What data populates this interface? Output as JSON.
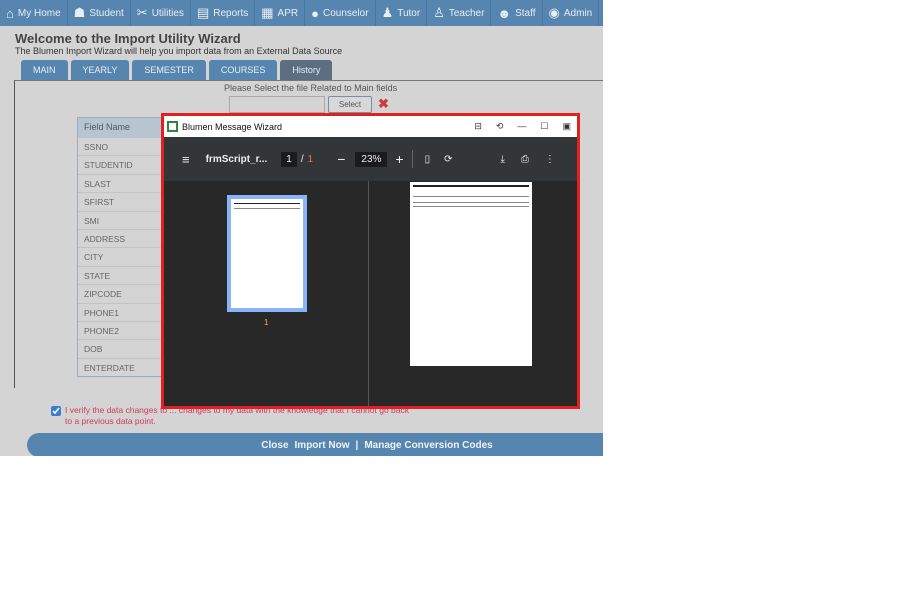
{
  "nav": [
    {
      "label": "My Home",
      "icon": "home-icon",
      "glyph": "⌂"
    },
    {
      "label": "Student",
      "icon": "student-icon",
      "glyph": "☗"
    },
    {
      "label": "Utilities",
      "icon": "tools-icon",
      "glyph": "✂"
    },
    {
      "label": "Reports",
      "icon": "reports-icon",
      "glyph": "▤"
    },
    {
      "label": "APR",
      "icon": "apr-icon",
      "glyph": "▦"
    },
    {
      "label": "Counselor",
      "icon": "counselor-icon",
      "glyph": "●"
    },
    {
      "label": "Tutor",
      "icon": "tutor-icon",
      "glyph": "♟"
    },
    {
      "label": "Teacher",
      "icon": "teacher-icon",
      "glyph": "♙"
    },
    {
      "label": "Staff",
      "icon": "staff-icon",
      "glyph": "☻"
    },
    {
      "label": "Admin",
      "icon": "admin-icon",
      "glyph": "◉"
    }
  ],
  "header": {
    "title": "Welcome to the Import Utility Wizard",
    "subtitle": "The Blumen Import Wizard will help you import data from an External Data Source"
  },
  "tabs": [
    {
      "label": "MAIN"
    },
    {
      "label": "YEARLY"
    },
    {
      "label": "SEMESTER"
    },
    {
      "label": "COURSES"
    },
    {
      "label": "History",
      "active": true
    }
  ],
  "file": {
    "label": "Please Select the file Related to Main fields",
    "value": "",
    "select": "Select"
  },
  "fields": {
    "header": "Field Name",
    "rows": [
      "SSNO",
      "STUDENTID",
      "SLAST",
      "SFIRST",
      "SMI",
      "ADDRESS",
      "CITY",
      "STATE",
      "ZIPCODE",
      "PHONE1",
      "PHONE2",
      "DOB",
      "ENTERDATE"
    ]
  },
  "verify": {
    "checked": true,
    "text": "I verify the data changes to ... changes to my data with the knowledge that I cannot go back to a previous data point."
  },
  "bottom": {
    "close": "Close",
    "import": "Import Now",
    "sep": "|",
    "manage": "Manage Conversion Codes"
  },
  "modal": {
    "title": "Blumen Message Wizard",
    "filename": "frmScript_r...",
    "page": "1",
    "sep": "/",
    "total": "1",
    "zoom": "23%",
    "thumb_page": "1"
  },
  "colors": {
    "nav": "#5686b0",
    "modal_border": "#e22020",
    "toolbar": "#323639"
  }
}
